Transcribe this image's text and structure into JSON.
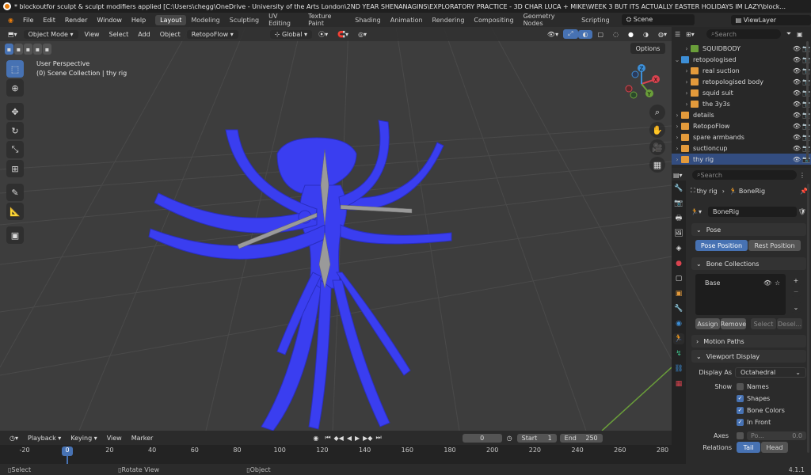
{
  "window_title": "* blockoutfor sculpt & sculpt modifiers applied [C:\\Users\\chegg\\OneDrive - University of the Arts London\\2ND YEAR SHENANAGINS\\EXPLORATORY PRACTICE - 3D CHAR LUCA + MIKE\\WEEK 3 BUT ITS ACTUALLY EASTER HOLIDAYS IM LAZY\\block...",
  "menu": [
    "File",
    "Edit",
    "Render",
    "Window",
    "Help"
  ],
  "workspaces": [
    "Layout",
    "Modeling",
    "Sculpting",
    "UV Editing",
    "Texture Paint",
    "Shading",
    "Animation",
    "Rendering",
    "Compositing",
    "Geometry Nodes",
    "Scripting"
  ],
  "active_workspace": "Layout",
  "scene": "Scene",
  "view_layer": "ViewLayer",
  "viewport": {
    "mode": "Object Mode",
    "menus": [
      "View",
      "Select",
      "Add",
      "Object"
    ],
    "addon": "RetopoFlow",
    "transform_orientation": "Global",
    "options_label": "Options",
    "perspective": "User Perspective",
    "collection_info": "(0) Scene Collection | thy rig",
    "axes": {
      "x": "X",
      "y": "Y",
      "z": "Z"
    }
  },
  "outliner": {
    "search_placeholder": "Search",
    "rows": [
      {
        "label": "SQUIDBODY",
        "color": "#6a9e3a"
      },
      {
        "label": "retopologised",
        "color": "#3d8ed6"
      },
      {
        "label": "real suction",
        "color": "#e39a3b"
      },
      {
        "label": "retopologised body",
        "color": "#e39a3b"
      },
      {
        "label": "squid suit",
        "color": "#e39a3b"
      },
      {
        "label": "the 3y3s",
        "color": "#e39a3b"
      },
      {
        "label": "details",
        "color": "#e39a3b"
      },
      {
        "label": "RetopoFlow",
        "color": "#e39a3b"
      },
      {
        "label": "spare armbands",
        "color": "#e39a3b"
      },
      {
        "label": "suctioncup",
        "color": "#e39a3b"
      },
      {
        "label": "thy rig",
        "color": "#e39a3b"
      }
    ]
  },
  "properties": {
    "search_placeholder": "Search",
    "breadcrumb_object": "thy rig",
    "breadcrumb_data": "BoneRig",
    "data_name": "BoneRig",
    "pose_panel": "Pose",
    "pose_position": "Pose Position",
    "rest_position": "Rest Position",
    "bone_collections_panel": "Bone Collections",
    "bone_collection_item": "Base",
    "assign": "Assign",
    "remove": "Remove",
    "select": "Select",
    "deselect": "Desel...",
    "motion_paths_panel": "Motion Paths",
    "viewport_display_panel": "Viewport Display",
    "display_as_label": "Display As",
    "display_as_value": "Octahedral",
    "show_label": "Show",
    "names": "Names",
    "shapes": "Shapes",
    "bone_colors": "Bone Colors",
    "in_front": "In Front",
    "axes_label": "Axes",
    "axes_pos": "Po...",
    "axes_value": "0.0",
    "relations_label": "Relations",
    "tail": "Tail",
    "head": "Head"
  },
  "timeline": {
    "menus": [
      "Playback",
      "Keying",
      "View",
      "Marker"
    ],
    "current_frame": "0",
    "start_label": "Start",
    "start_value": "1",
    "end_label": "End",
    "end_value": "250",
    "ticks": [
      "-20",
      "0",
      "20",
      "40",
      "60",
      "80",
      "100",
      "120",
      "140",
      "160",
      "180",
      "200",
      "220",
      "240",
      "260",
      "280"
    ],
    "playhead": "0"
  },
  "status": {
    "select": "Select",
    "rotate_view": "Rotate View",
    "object": "Object",
    "version": "4.1.1"
  },
  "colors": {
    "accent": "#4772b3",
    "model": "#3a3ef0"
  }
}
